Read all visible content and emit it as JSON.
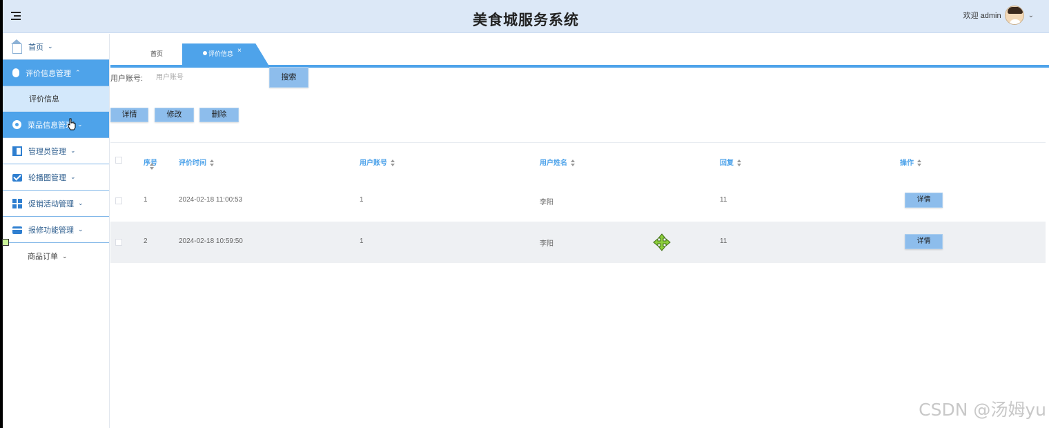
{
  "header": {
    "title": "美食城服务系统",
    "welcome": "欢迎 admin"
  },
  "sidebar": {
    "items": [
      {
        "label": "首页",
        "icon": "home-icon"
      },
      {
        "label": "评价信息管理",
        "icon": "mouse-icon",
        "active": true,
        "sub": [
          "评价信息"
        ]
      },
      {
        "label": "菜品信息管理",
        "icon": "disc-icon",
        "active": true
      },
      {
        "label": "管理员管理",
        "icon": "panel-icon"
      },
      {
        "label": "轮播图管理",
        "icon": "mail-icon"
      },
      {
        "label": "促销活动管理",
        "icon": "grid-icon"
      },
      {
        "label": "报修功能管理",
        "icon": "wallet-icon"
      },
      {
        "label": "商品订单"
      }
    ]
  },
  "tabs": {
    "home": "首页",
    "active": "评价信息",
    "close": "×"
  },
  "search": {
    "label": "用户账号:",
    "placeholder": "用户账号",
    "button": "搜索"
  },
  "actions": {
    "detail": "详情",
    "edit": "修改",
    "delete": "删除"
  },
  "table": {
    "columns": [
      "序号",
      "评价时间",
      "用户账号",
      "用户姓名",
      "回复",
      "操作"
    ],
    "rows": [
      {
        "no": "1",
        "time": "2024-02-18 11:00:53",
        "account": "1",
        "name": "李阳",
        "reply": "11",
        "op": "详情"
      },
      {
        "no": "2",
        "time": "2024-02-18 10:59:50",
        "account": "1",
        "name": "李阳",
        "reply": "11",
        "op": "详情"
      }
    ]
  },
  "watermark": "CSDN @汤姆yu",
  "colors": {
    "header_bg": "#dce8f7",
    "accent": "#4ea3ea",
    "button": "#8dbdec",
    "submenu_bg": "#d3e8fb"
  }
}
